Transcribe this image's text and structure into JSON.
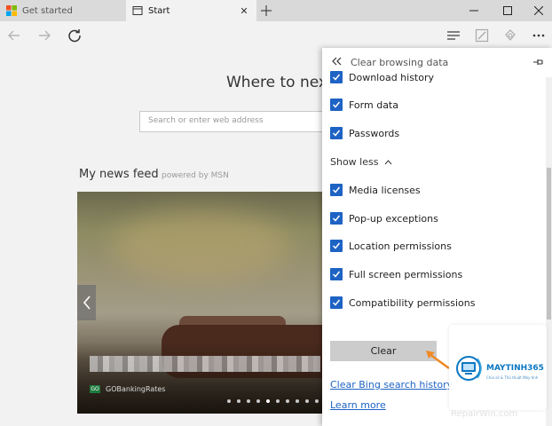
{
  "tabs": [
    {
      "title": "Get started",
      "active": false
    },
    {
      "title": "Start",
      "active": true
    }
  ],
  "icons": {
    "new_tab": "plus-icon",
    "minimize": "minimize-icon",
    "maximize": "maximize-icon",
    "close": "close-icon",
    "back": "back-arrow-icon",
    "forward": "forward-arrow-icon",
    "refresh": "refresh-icon",
    "hub": "hub-icon",
    "web_note": "web-note-icon",
    "share": "share-icon",
    "more": "more-icon"
  },
  "start": {
    "headline": "Where to next?",
    "search_placeholder": "Search or enter web address",
    "feed_title": "My news feed",
    "powered_by": "powered by MSN",
    "news_source": "GOBankingRates",
    "carousel_count": 10,
    "carousel_active": 5
  },
  "panel": {
    "title": "Clear browsing data",
    "items_top": [
      {
        "label": "Download history",
        "checked": true
      },
      {
        "label": "Form data",
        "checked": true
      },
      {
        "label": "Passwords",
        "checked": true
      }
    ],
    "show_less": "Show less",
    "items_more": [
      {
        "label": "Media licenses",
        "checked": true
      },
      {
        "label": "Pop-up exceptions",
        "checked": true
      },
      {
        "label": "Location permissions",
        "checked": true
      },
      {
        "label": "Full screen permissions",
        "checked": true
      },
      {
        "label": "Compatibility permissions",
        "checked": true
      }
    ],
    "clear_label": "Clear",
    "bing_link": "Clear Bing search history",
    "learn_more": "Learn more"
  },
  "overlay": {
    "brand_name": "MAYTINH365",
    "brand_tag": "Chia sẻ & Thủ thuật Máy tính",
    "watermark": "RepairWin.com"
  },
  "colors": {
    "accent": "#1e63c4",
    "panel_bg": "#ffffff",
    "chrome_bg": "#f2f2f2",
    "arrow": "#f08a24"
  }
}
